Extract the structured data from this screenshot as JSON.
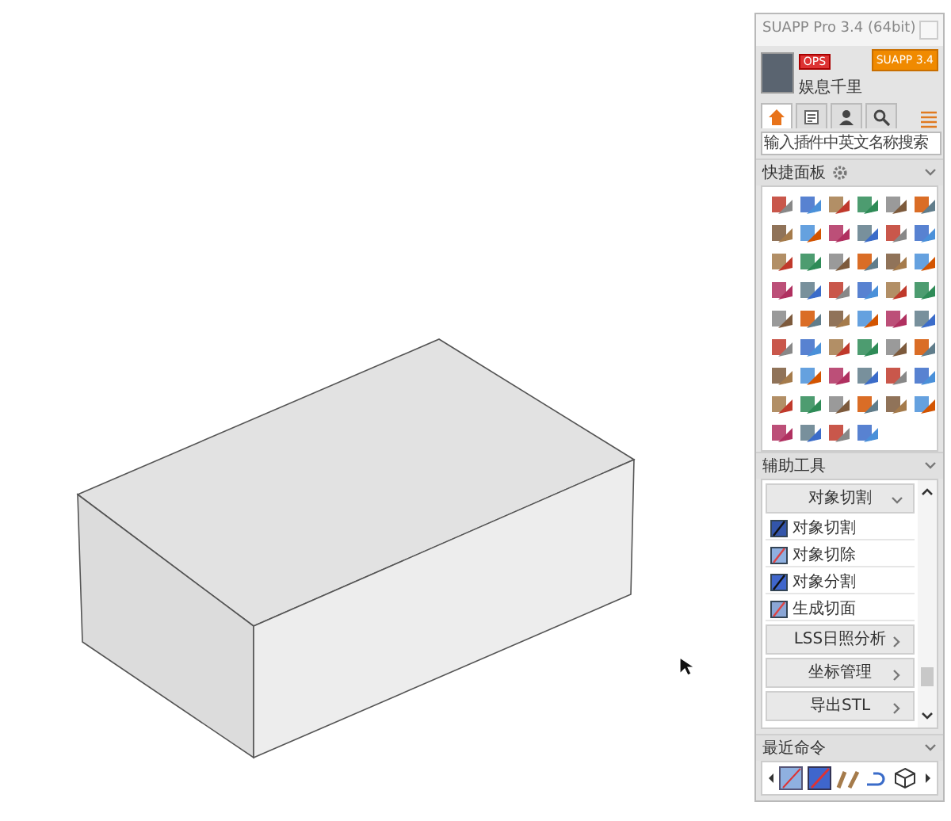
{
  "window": {
    "title": "SUAPP Pro 3.4 (64bit)"
  },
  "user": {
    "badge": "OPS",
    "name": "娱息千里",
    "version_button": "SUAPP 3.4"
  },
  "tabs": [
    {
      "kind": "home",
      "selected": true
    },
    {
      "kind": "document",
      "selected": false
    },
    {
      "kind": "person",
      "selected": false
    },
    {
      "kind": "search",
      "selected": false
    }
  ],
  "search": {
    "placeholder": "输入插件中英文名称搜索"
  },
  "quick_panel": {
    "title": "快捷面板",
    "expanded": true
  },
  "aux_tools": {
    "title": "辅助工具",
    "expanded": true,
    "groups": [
      {
        "label": "对象切割",
        "expanded": true,
        "items": [
          {
            "label": "对象切割"
          },
          {
            "label": "对象切除"
          },
          {
            "label": "对象分割"
          },
          {
            "label": "生成切面"
          }
        ]
      },
      {
        "label": "LSS日照分析",
        "expanded": false
      },
      {
        "label": "坐标管理",
        "expanded": false
      },
      {
        "label": "导出STL",
        "expanded": false
      }
    ]
  },
  "recent": {
    "title": "最近命令",
    "expanded": true
  }
}
